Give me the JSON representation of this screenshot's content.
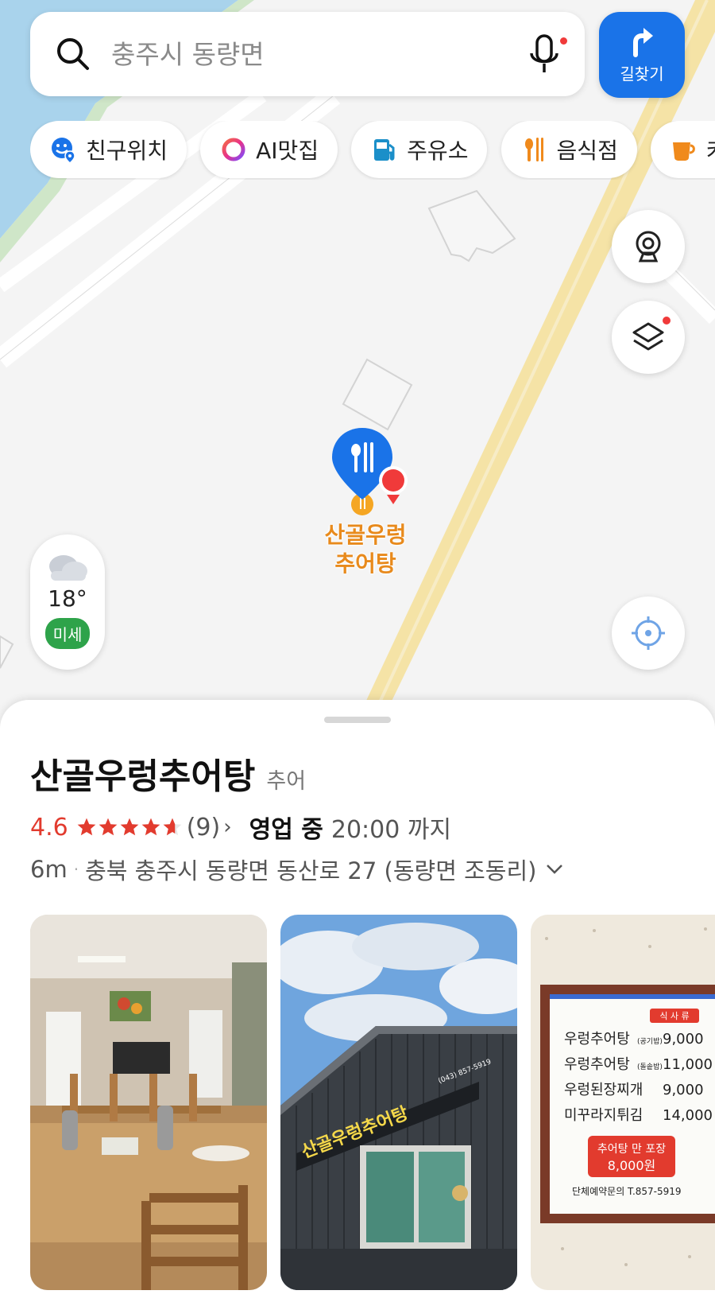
{
  "search": {
    "placeholder": "충주시 동량면"
  },
  "directions": {
    "label": "길찾기"
  },
  "chips": [
    {
      "label": "친구위치",
      "icon": "friend-location-icon",
      "color": "#1a73e8"
    },
    {
      "label": "AI맛집",
      "icon": "ai-ring-icon",
      "color": "#e8318a"
    },
    {
      "label": "주유소",
      "icon": "gas-station-icon",
      "color": "#1b8fc9"
    },
    {
      "label": "음식점",
      "icon": "restaurant-icon",
      "color": "#f08a1c"
    },
    {
      "label": "카페",
      "icon": "cafe-icon",
      "color": "#f08a1c"
    }
  ],
  "weather": {
    "temperature": "18°",
    "dust_label": "미세",
    "icon": "cloud-icon"
  },
  "map_marker": {
    "label_line1": "산골우렁",
    "label_line2": "추어탕"
  },
  "place": {
    "name": "산골우렁추어탕",
    "category": "추어",
    "rating": "4.6",
    "stars": 4.6,
    "review_count": "(9)",
    "open_status": "영업 중",
    "open_hours": "20:00 까지",
    "distance": "6m",
    "address": "충북 충주시 동량면 동산로 27 (동량면 조동리)"
  },
  "menu_board": {
    "header": "식 사 류",
    "items": [
      {
        "name": "우렁추어탕",
        "note": "(공기밥)",
        "price": "9,000"
      },
      {
        "name": "우렁추어탕",
        "note": "(돌솥밥)",
        "price": "11,000"
      },
      {
        "name": "우렁된장찌개",
        "note": "",
        "price": "9,000"
      },
      {
        "name": "미꾸라지튀김",
        "note": "",
        "price": "14,000"
      }
    ],
    "promo_line1": "추어탕 만 포장",
    "promo_line2": "8,000원",
    "contact": "단체예약문의 T.857-5919"
  },
  "sign": {
    "text": "산골우렁추어탕",
    "phone": "(043) 857-5919"
  },
  "colors": {
    "accent": "#1a73e8",
    "rating": "#e23b2e",
    "marker_label": "#e88a1c",
    "dust_badge": "#2ea34a"
  }
}
